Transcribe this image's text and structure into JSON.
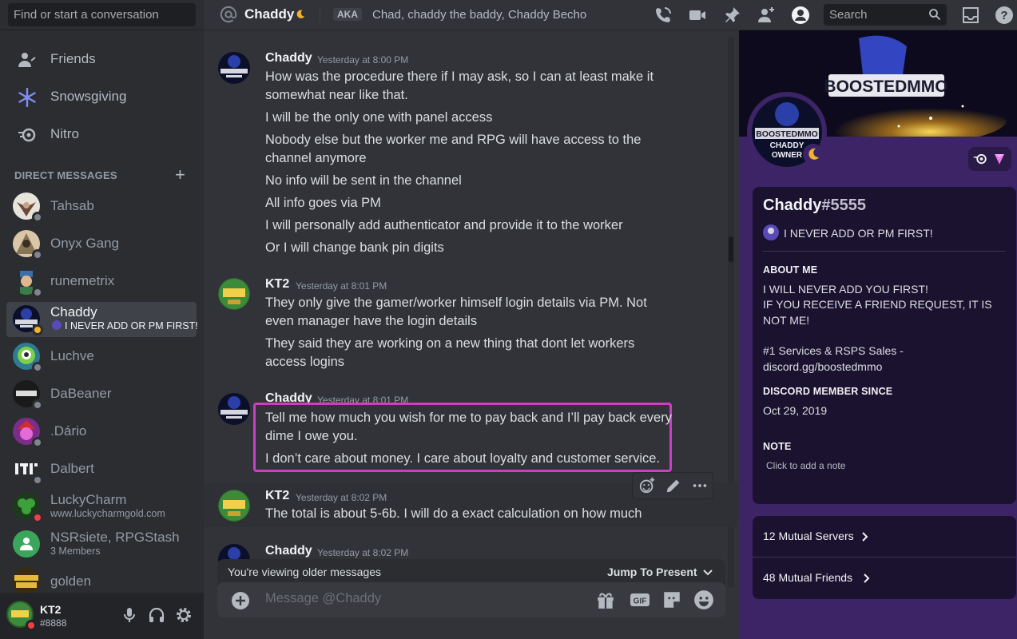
{
  "sidebar": {
    "find_placeholder": "Find or start a conversation",
    "nav": [
      {
        "label": "Friends",
        "icon": "friends-icon"
      },
      {
        "label": "Snowsgiving",
        "icon": "snowflake-icon"
      },
      {
        "label": "Nitro",
        "icon": "nitro-icon"
      }
    ],
    "dm_header": "DIRECT MESSAGES",
    "dms": [
      {
        "name": "Tahsab"
      },
      {
        "name": "Onyx Gang"
      },
      {
        "name": "runemetrix"
      },
      {
        "name": "Chaddy",
        "sub": "I NEVER ADD OR PM FIRST!"
      },
      {
        "name": "Luchve"
      },
      {
        "name": "DaBeaner"
      },
      {
        "name": ".Dário"
      },
      {
        "name": "Dalbert"
      },
      {
        "name": "LuckyCharm",
        "sub": "www.luckycharmgold.com"
      },
      {
        "name": "NSRsiete, RPGStash",
        "sub": "3 Members"
      },
      {
        "name": "golden"
      }
    ],
    "user": {
      "name": "KT2",
      "tag": "#8888"
    }
  },
  "header": {
    "name": "Chaddy",
    "aka_label": "AKA",
    "aka_names": "Chad, chaddy the baddy, Chaddy Becho",
    "search_placeholder": "Search"
  },
  "messages": [
    {
      "author": "Chaddy",
      "time": "Yesterday at 8:00 PM",
      "lines": [
        "How was the procedure there if I may ask, so I can at least make it somewhat near like that.",
        "I will be the only one with panel access",
        "Nobody else but the worker me and RPG will have access to the channel anymore",
        "No info will be sent in the channel",
        "All info goes via PM",
        "I will personally add authenticator and provide it to the worker",
        "Or I will change bank pin digits"
      ]
    },
    {
      "author": "KT2",
      "time": "Yesterday at 8:01 PM",
      "lines": [
        "They only give the gamer/worker himself login details via PM. Not even manager have the login details",
        "They said they are working on a new thing that dont let workers access logins"
      ]
    },
    {
      "author": "Chaddy",
      "time": "Yesterday at 8:01 PM",
      "lines": [
        "Tell me how much you wish for me to pay back and I’ll pay back every dime I owe you.",
        "I don’t care about money. I care about loyalty and customer service."
      ]
    },
    {
      "author": "KT2",
      "time": "Yesterday at 8:02 PM",
      "lines": [
        "The total is about 5-6b. I will do a exact calculation on how much"
      ]
    },
    {
      "author": "Chaddy",
      "time": "Yesterday at 8:02 PM",
      "lines": []
    }
  ],
  "chat": {
    "older_text": "You're viewing older messages",
    "jump_text": "Jump To Present",
    "composer_placeholder": "Message @Chaddy"
  },
  "profile": {
    "banner_text": "BOOSTEDMMO",
    "avatar_text": [
      "BOOSTEDMMO",
      "CHADDY",
      "OWNER"
    ],
    "name": "Chaddy",
    "discriminator": "#5555",
    "status": "I NEVER ADD OR PM FIRST!",
    "about_h": "ABOUT ME",
    "about": [
      "I WILL NEVER ADD YOU FIRST!",
      "IF YOU RECEIVE A FRIEND REQUEST, IT IS NOT ME!",
      "",
      "#1 Services & RSPS Sales - discord.gg/boostedmmo"
    ],
    "member_since_h": "DISCORD MEMBER SINCE",
    "member_since": "Oct 29, 2019",
    "note_h": "NOTE",
    "note_ph": "Click to add a note",
    "mutual_servers": "12 Mutual Servers",
    "mutual_friends": "48 Mutual Friends"
  },
  "colors": {
    "accent": "#5865f2",
    "highlight_box": "#c93fc8",
    "profile_bg": "#3d2466",
    "idle": "#f0b232",
    "dnd": "#f23f43"
  }
}
